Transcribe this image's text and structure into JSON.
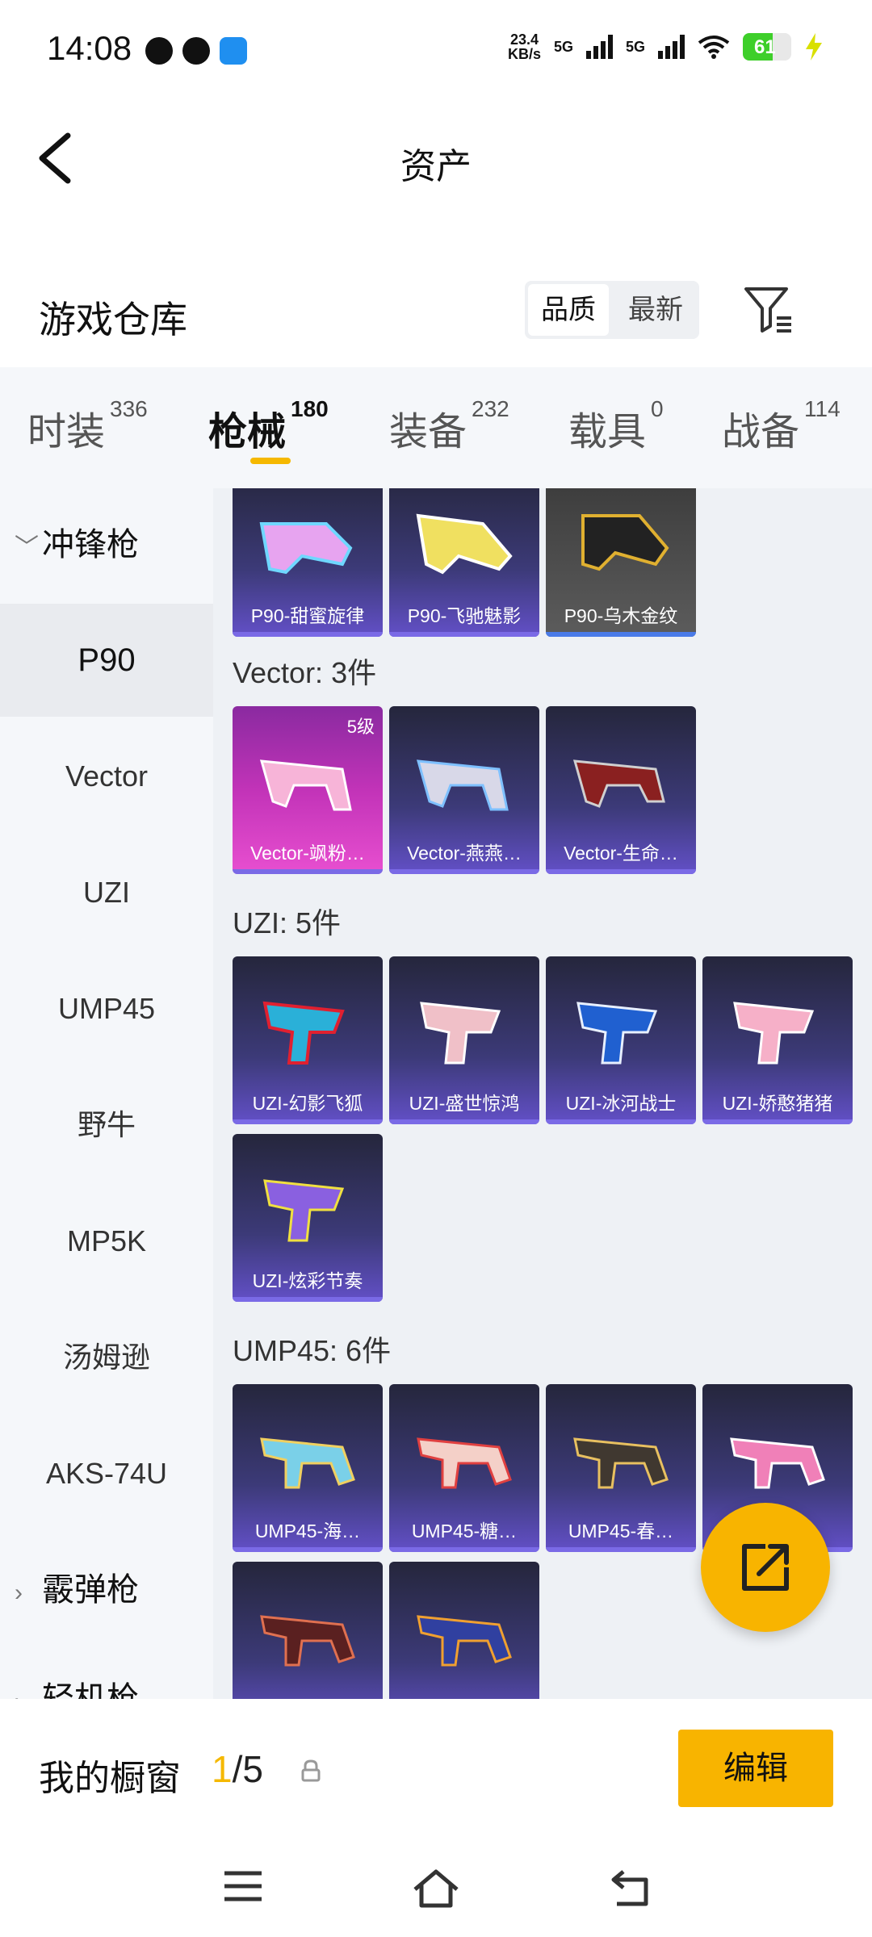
{
  "status_bar": {
    "time": "14:08",
    "speed_value": "23.4",
    "speed_unit": "KB/s",
    "sim1": "5G",
    "sim2": "5G",
    "battery": "61"
  },
  "header": {
    "title": "资产"
  },
  "warehouse": {
    "title": "游戏仓库",
    "sort_options": [
      "品质",
      "最新"
    ],
    "active_sort": "品质"
  },
  "tabs": [
    {
      "label": "时装",
      "count": "336"
    },
    {
      "label": "枪械",
      "count": "180"
    },
    {
      "label": "装备",
      "count": "232"
    },
    {
      "label": "载具",
      "count": "0"
    },
    {
      "label": "战备",
      "count": "114"
    }
  ],
  "sidebar": {
    "group_open": "冲锋枪",
    "items": [
      "P90",
      "Vector",
      "UZI",
      "UMP45",
      "野牛",
      "MP5K",
      "汤姆逊",
      "AKS-74U"
    ],
    "group_closed": "霰弹枪",
    "group_partial": "轻机枪"
  },
  "groups": {
    "p90": {
      "items": [
        "P90-甜蜜旋律",
        "P90-飞驰魅影",
        "P90-乌木金纹"
      ]
    },
    "vector": {
      "label": "Vector: 3件",
      "items": [
        "Vector-飒粉…",
        "Vector-燕燕…",
        "Vector-生命…"
      ],
      "level": "5级"
    },
    "uzi": {
      "label": "UZI: 5件",
      "items": [
        "UZI-幻影飞狐",
        "UZI-盛世惊鸿",
        "UZI-冰河战士",
        "UZI-娇憨猪猪",
        "UZI-炫彩节奏"
      ]
    },
    "ump45": {
      "label": "UMP45: 6件",
      "items": [
        "UMP45-海…",
        "UMP45-糖…",
        "UMP45-春…",
        "UMP45-…"
      ]
    }
  },
  "showcase": {
    "label": "我的橱窗",
    "current": "1",
    "total": "/5",
    "edit_label": "编辑"
  },
  "colors": {
    "accent": "#f8b400",
    "card_purple": "#3c3a78",
    "card_pink": "#c233b8"
  }
}
